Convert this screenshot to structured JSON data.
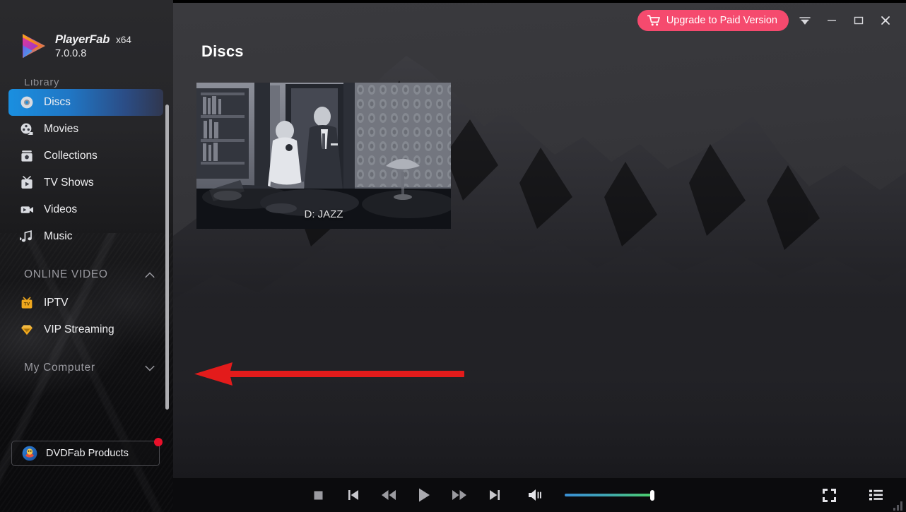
{
  "app": {
    "brand_name": "PlayerFab",
    "architecture": "x64",
    "version": "7.0.0.8",
    "logo_icon": "playerfab-logo-icon"
  },
  "header": {
    "upgrade_label": "Upgrade to Paid Version",
    "cart_icon": "shopping-cart-icon",
    "menu_icon": "menu-caret-down-icon",
    "minimize_icon": "minimize-icon",
    "maximize_icon": "maximize-icon",
    "close_icon": "close-icon",
    "accent_color": "#f54a6e"
  },
  "sidebar": {
    "library_label": "Library",
    "items": [
      {
        "label": "Discs",
        "icon": "disc-icon",
        "active": true
      },
      {
        "label": "Movies",
        "icon": "film-reel-icon",
        "active": false
      },
      {
        "label": "Collections",
        "icon": "collection-icon",
        "active": false
      },
      {
        "label": "TV Shows",
        "icon": "tv-icon",
        "active": false
      },
      {
        "label": "Videos",
        "icon": "video-camera-icon",
        "active": false
      },
      {
        "label": "Music",
        "icon": "music-note-icon",
        "active": false
      }
    ],
    "online_video": {
      "label": "ONLINE VIDEO",
      "chevron": "chevron-up-icon",
      "expanded": true,
      "items": [
        {
          "label": "IPTV",
          "icon": "iptv-icon"
        },
        {
          "label": "VIP Streaming",
          "icon": "vip-diamond-icon"
        }
      ]
    },
    "my_computer": {
      "label": "My Computer",
      "chevron": "chevron-down-icon",
      "expanded": false
    },
    "dvdfab_products": {
      "label": "DVDFab Products",
      "icon": "dvdfab-icon",
      "badge": true,
      "badge_color": "#e8102a"
    },
    "active_highlight_color": "#1a8fe0"
  },
  "main": {
    "page_title": "Discs",
    "discs": [
      {
        "caption": "D: JAZZ",
        "thumbnail": "bw-film-still-thumbnail"
      }
    ]
  },
  "annotation": {
    "arrow_color": "#e31b1b",
    "arrow_direction": "left",
    "name": "red-arrow-annotation"
  },
  "controls": {
    "buttons": [
      {
        "name": "stop-button",
        "icon": "stop-icon"
      },
      {
        "name": "previous-button",
        "icon": "previous-icon"
      },
      {
        "name": "rewind-button",
        "icon": "rewind-icon"
      },
      {
        "name": "play-button",
        "icon": "play-icon"
      },
      {
        "name": "fast-forward-button",
        "icon": "fast-forward-icon"
      },
      {
        "name": "next-button",
        "icon": "next-icon"
      }
    ],
    "volume": {
      "icon": "volume-icon",
      "level": 100,
      "fill_start_color": "#3a8fd4",
      "fill_end_color": "#4ccf6a"
    },
    "right_buttons": [
      {
        "name": "fullscreen-button",
        "icon": "fullscreen-icon"
      },
      {
        "name": "playlist-button",
        "icon": "playlist-icon"
      }
    ]
  }
}
